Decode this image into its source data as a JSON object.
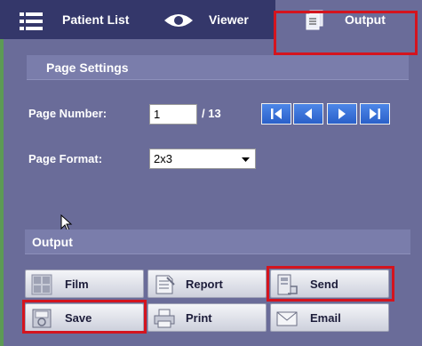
{
  "tabs": [
    {
      "label": "Patient List",
      "icon": "list-icon"
    },
    {
      "label": "Viewer",
      "icon": "eye-icon"
    },
    {
      "label": "Output",
      "icon": "document-stack-icon",
      "active": true
    }
  ],
  "page_settings": {
    "title": "Page Settings",
    "page_number_label": "Page Number:",
    "page_number_value": "1",
    "page_total": "/ 13",
    "page_format_label": "Page Format:",
    "page_format_value": "2x3"
  },
  "output": {
    "title": "Output",
    "buttons": [
      {
        "label": "Film",
        "icon": "film-grid-icon"
      },
      {
        "label": "Report",
        "icon": "report-icon"
      },
      {
        "label": "Send",
        "icon": "send-icon"
      },
      {
        "label": "Save",
        "icon": "save-icon"
      },
      {
        "label": "Print",
        "icon": "printer-icon"
      },
      {
        "label": "Email",
        "icon": "envelope-icon"
      }
    ]
  },
  "colors": {
    "background": "#6a6c99",
    "tabbar": "#34376a",
    "highlight": "#d4141e",
    "nav_button": "#2a60c9"
  }
}
